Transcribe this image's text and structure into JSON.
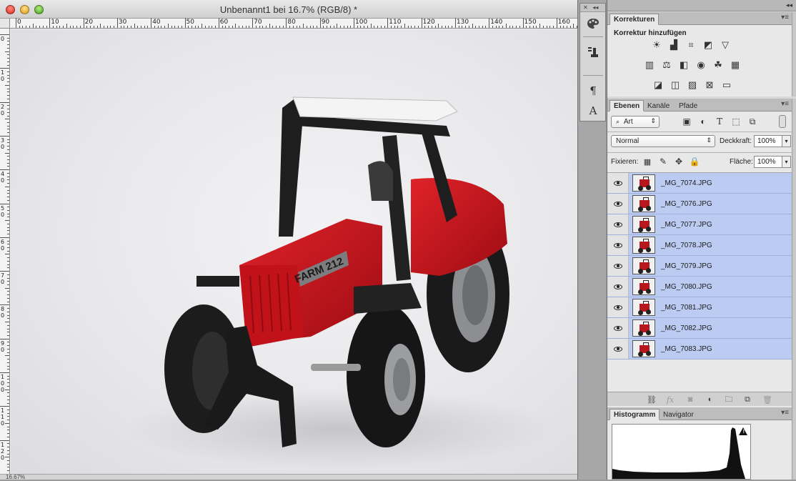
{
  "document": {
    "title": "Unbenannt1 bei 16.7% (RGB/8) *",
    "zoom_readout": "16.67%",
    "ruler_h_labels": [
      "0",
      "10",
      "20",
      "30",
      "40",
      "50",
      "60",
      "70",
      "80",
      "90",
      "100",
      "110",
      "120",
      "130",
      "140",
      "150",
      "160"
    ],
    "ruler_v_labels": [
      "0",
      "10",
      "20",
      "30",
      "40",
      "50",
      "60",
      "70",
      "80",
      "90",
      "100",
      "110",
      "120"
    ],
    "photo_label": "FARM 212"
  },
  "tool_dock": {
    "items": [
      {
        "name": "color-palette-icon",
        "glyph": "🎨"
      },
      {
        "name": "brush-presets-icon",
        "glyph": "🖌"
      },
      {
        "name": "paragraph-icon",
        "glyph": "¶"
      },
      {
        "name": "character-icon",
        "glyph": "A"
      }
    ]
  },
  "panels": {
    "adjustments": {
      "tab": "Korrekturen",
      "title": "Korrektur hinzufügen",
      "row1": [
        "brightness-contrast-icon",
        "levels-icon",
        "curves-icon",
        "exposure-icon",
        "vibrance-icon"
      ],
      "row2": [
        "hue-saturation-icon",
        "color-balance-icon",
        "black-white-icon",
        "photo-filter-icon",
        "channel-mixer-icon",
        "color-lookup-icon"
      ],
      "row3": [
        "invert-icon",
        "posterize-icon",
        "threshold-icon",
        "selective-color-icon",
        "gradient-map-icon"
      ]
    },
    "layers": {
      "tabs": [
        "Ebenen",
        "Kanäle",
        "Pfade"
      ],
      "filter_label": "Art",
      "blend_mode": "Normal",
      "opacity_label": "Deckkraft:",
      "opacity_value": "100%",
      "lock_label": "Fixieren:",
      "fill_label": "Fläche:",
      "fill_value": "100%",
      "items": [
        {
          "name": "_MG_7074.JPG"
        },
        {
          "name": "_MG_7076.JPG"
        },
        {
          "name": "_MG_7077.JPG"
        },
        {
          "name": "_MG_7078.JPG"
        },
        {
          "name": "_MG_7079.JPG"
        },
        {
          "name": "_MG_7080.JPG"
        },
        {
          "name": "_MG_7081.JPG"
        },
        {
          "name": "_MG_7082.JPG"
        },
        {
          "name": "_MG_7083.JPG"
        }
      ]
    },
    "histogram": {
      "tabs": [
        "Histogramm",
        "Navigator"
      ]
    }
  },
  "colors": {
    "layer_selected": "#bccbf2",
    "tractor_red": "#c8141c"
  }
}
